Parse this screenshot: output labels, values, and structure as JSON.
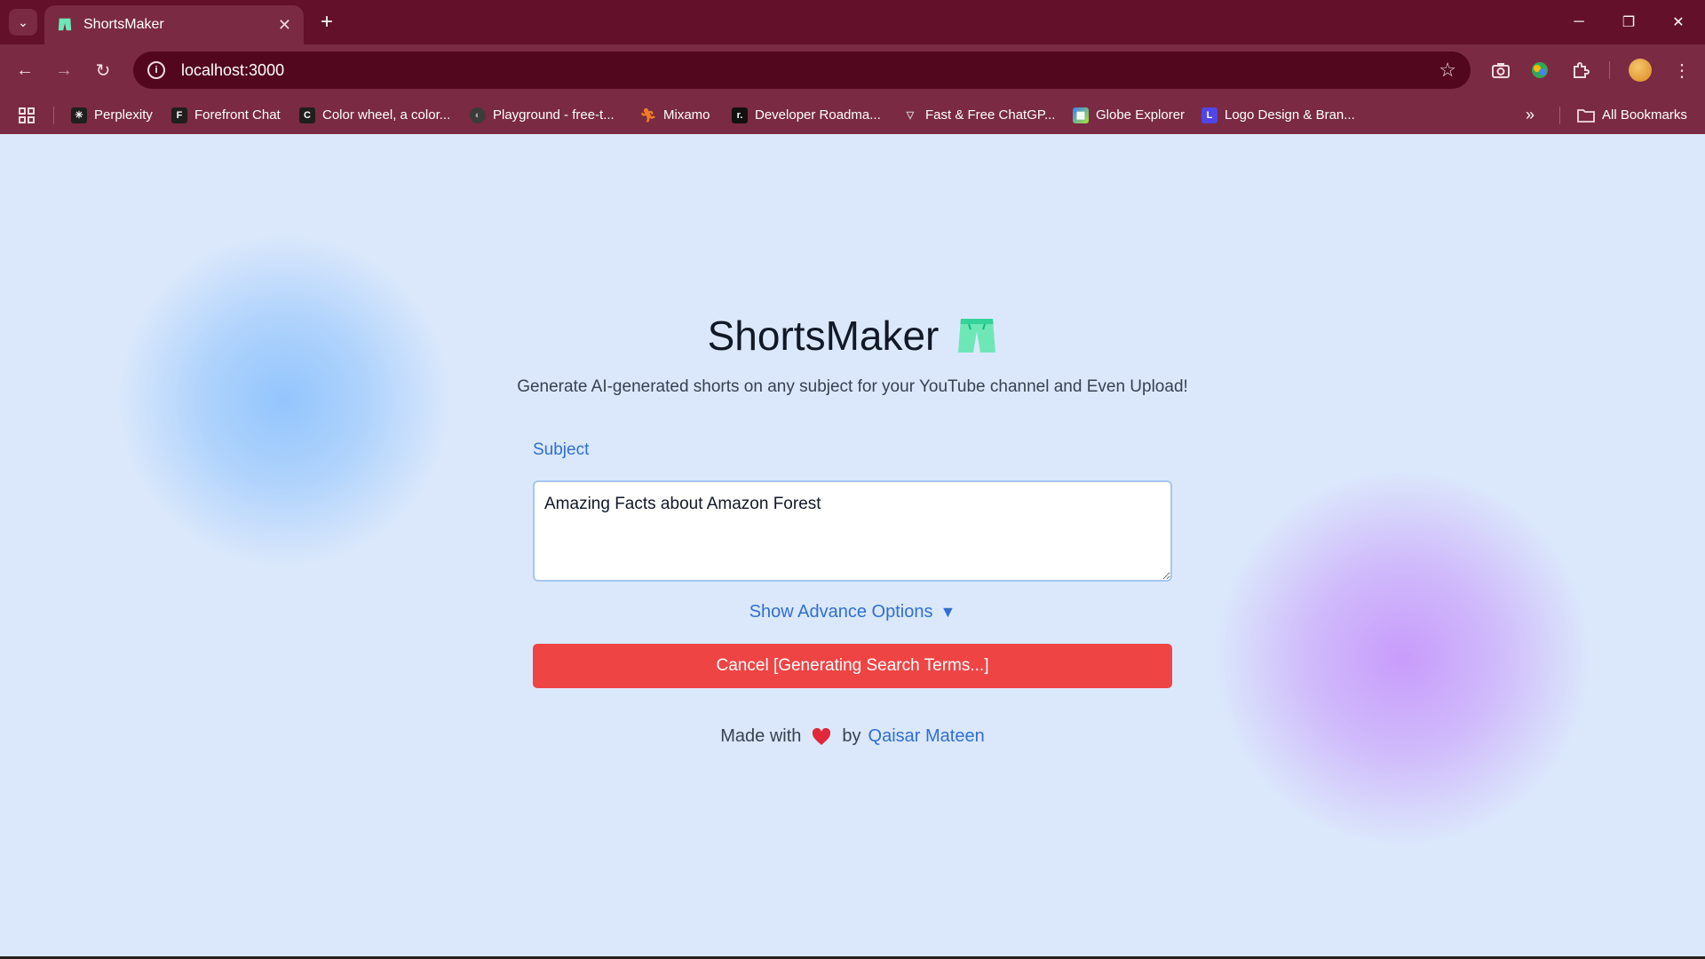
{
  "browser": {
    "tab_title": "ShortsMaker",
    "url": "localhost:3000",
    "bookmarks": [
      {
        "label": "Perplexity",
        "icon": "perplexity-icon",
        "color": "#1f1f1f"
      },
      {
        "label": "Forefront Chat",
        "icon": "forefront-icon",
        "color": "#1f1f1f"
      },
      {
        "label": "Color wheel, a color...",
        "icon": "color-wheel-icon",
        "color": "#1f1f1f"
      },
      {
        "label": "Playground - free-t...",
        "icon": "playground-icon",
        "color": "#3b3b3b"
      },
      {
        "label": "Mixamo",
        "icon": "mixamo-icon",
        "color": "#f07c22"
      },
      {
        "label": "Developer Roadma...",
        "icon": "roadmap-icon",
        "color": "#111111"
      },
      {
        "label": "Fast & Free ChatGP...",
        "icon": "chatgpt-icon",
        "color": "#555555"
      },
      {
        "label": "Globe Explorer",
        "icon": "globe-icon",
        "color": "#3b82f6"
      },
      {
        "label": "Logo Design & Bran...",
        "icon": "logo-design-icon",
        "color": "#4f46e5"
      }
    ],
    "all_bookmarks": "All Bookmarks"
  },
  "app": {
    "title": "ShortsMaker",
    "subtitle": "Generate AI-generated shorts on any subject for your YouTube channel and Even Upload!",
    "subject_label": "Subject",
    "subject_value": "Amazing Facts about Amazon Forest",
    "advance_toggle": "Show Advance Options",
    "advance_arrow": "▼",
    "cancel_button": "Cancel [Generating Search Terms...]",
    "footer": {
      "made_with": "Made with",
      "by": "by",
      "author": "Qaisar Mateen"
    },
    "colors": {
      "background": "#dbe8fb",
      "accent": "#2f6fd1",
      "danger": "#ef4444",
      "shorts_icon": "#6ee7b7"
    }
  }
}
